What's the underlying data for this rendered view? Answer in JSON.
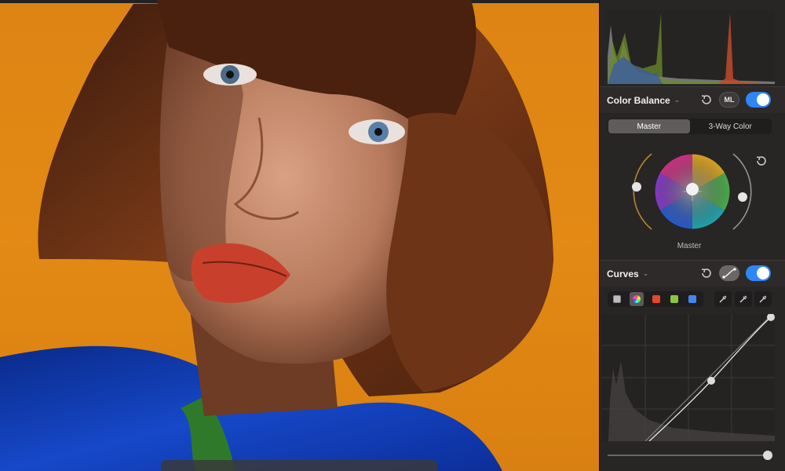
{
  "color_balance": {
    "title": "Color Balance",
    "ml_label": "ML",
    "enabled": true,
    "tabs": [
      "Master",
      "3-Way Color"
    ],
    "active_tab": "Master",
    "wheel_label": "Master"
  },
  "curves": {
    "title": "Curves",
    "enabled": true,
    "channels": [
      "white",
      "rgb",
      "red",
      "green",
      "blue"
    ],
    "selected_channel": "rgb",
    "pickers": [
      "black-point-picker-icon",
      "gray-point-picker-icon",
      "white-point-picker-icon"
    ]
  },
  "colors": {
    "accent": "#2f86f6",
    "background_orange": "#e08613"
  }
}
